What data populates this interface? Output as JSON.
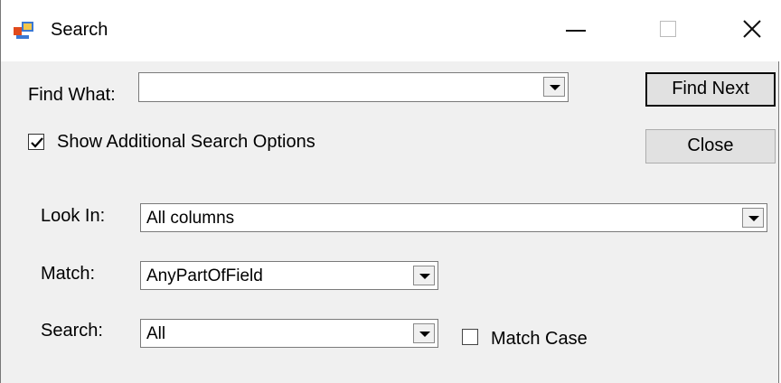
{
  "window": {
    "title": "Search",
    "icon": "search-window-icon",
    "controls": {
      "minimize": "minimize-icon",
      "maximize": "maximize-icon",
      "close": "close-icon"
    }
  },
  "find": {
    "label": "Find What:",
    "value": "",
    "find_next_label": "Find Next",
    "close_label": "Close"
  },
  "options": {
    "show_additional_label": "Show Additional Search Options",
    "show_additional_checked": true,
    "look_in_label": "Look In:",
    "look_in_value": "All columns",
    "match_label": "Match:",
    "match_value": "AnyPartOfField",
    "search_label": "Search:",
    "search_value": "All",
    "match_case_label": "Match Case",
    "match_case_checked": false
  },
  "colors": {
    "window_bg": "#f0f0f0",
    "titlebar_bg": "#ffffff",
    "button_bg": "#e1e1e1"
  }
}
